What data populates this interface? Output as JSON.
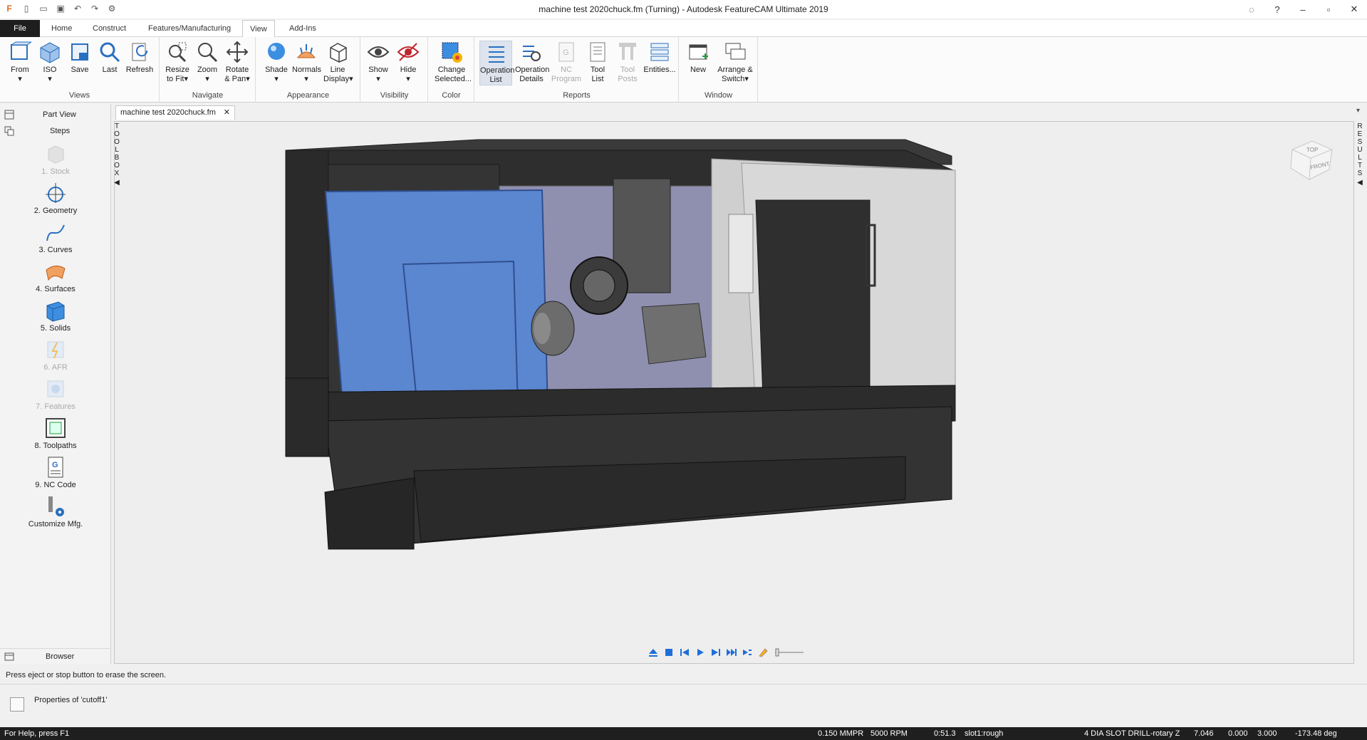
{
  "window": {
    "title": "machine test 2020chuck.fm (Turning) - Autodesk FeatureCAM Ultimate 2019"
  },
  "ribbon_tabs": [
    "File",
    "Home",
    "Construct",
    "Features/Manufacturing",
    "View",
    "Add-Ins"
  ],
  "active_tab": "View",
  "groups": {
    "views": {
      "label": "Views",
      "buttons": [
        {
          "label": "From",
          "sub": "▾"
        },
        {
          "label": "ISO",
          "sub": "▾"
        },
        {
          "label": "Save",
          "sub": ""
        },
        {
          "label": "Last",
          "sub": ""
        },
        {
          "label": "Refresh",
          "sub": ""
        }
      ]
    },
    "navigate": {
      "label": "Navigate",
      "buttons": [
        {
          "label": "Resize",
          "sub": "to Fit▾"
        },
        {
          "label": "Zoom",
          "sub": "▾"
        },
        {
          "label": "Rotate",
          "sub": "& Pan▾"
        }
      ]
    },
    "appearance": {
      "label": "Appearance",
      "buttons": [
        {
          "label": "Shade",
          "sub": "▾"
        },
        {
          "label": "Normals",
          "sub": "▾"
        },
        {
          "label": "Line",
          "sub": "Display▾"
        }
      ]
    },
    "visibility": {
      "label": "Visibility",
      "buttons": [
        {
          "label": "Show",
          "sub": "▾"
        },
        {
          "label": "Hide",
          "sub": "▾"
        }
      ]
    },
    "color": {
      "label": "Color",
      "buttons": [
        {
          "label": "Change",
          "sub": "Selected..."
        }
      ]
    },
    "reports": {
      "label": "Reports",
      "buttons": [
        {
          "label": "Operation",
          "sub": "List"
        },
        {
          "label": "Operation",
          "sub": "Details"
        },
        {
          "label": "NC",
          "sub": "Program"
        },
        {
          "label": "Tool",
          "sub": "List"
        },
        {
          "label": "Tool",
          "sub": "Posts"
        },
        {
          "label": "Entities...",
          "sub": ""
        }
      ]
    },
    "window": {
      "label": "Window",
      "buttons": [
        {
          "label": "New",
          "sub": ""
        },
        {
          "label": "Arrange &",
          "sub": "Switch▾"
        }
      ]
    }
  },
  "left_panel": {
    "part_view": "Part View",
    "steps": "Steps",
    "browser": "Browser",
    "items": [
      "1.  Stock",
      "2.  Geometry",
      "3.  Curves",
      "4.  Surfaces",
      "5.  Solids",
      "6.  AFR",
      "7.  Features",
      "8.  Toolpaths",
      "9.  NC Code",
      "Customize Mfg."
    ]
  },
  "document_tab": "machine test 2020chuck.fm",
  "toolbox_label": "TOOLBOX",
  "results_label": "RESULTS",
  "nav_cube": {
    "top": "TOP",
    "front": "FRONT"
  },
  "message": "Press eject or stop button to erase the screen.",
  "properties_label": "Properties of 'cutoff1'",
  "status": {
    "help": "For Help, press F1",
    "feed": "0.150 MMPR",
    "rpm": "5000 RPM",
    "time": "0:51.3",
    "operation": "slot1:rough",
    "feature": "4 DIA SLOT DRILL-rotary Z",
    "x": "7.046",
    "y": "0.000",
    "z": "3.000",
    "angle": "-173.48 deg"
  },
  "colors": {
    "accent": "#1e6fd9",
    "door_blue": "#5b86d0",
    "machine_dark": "#2e2e2e",
    "status_bg": "#1f1f1f"
  }
}
